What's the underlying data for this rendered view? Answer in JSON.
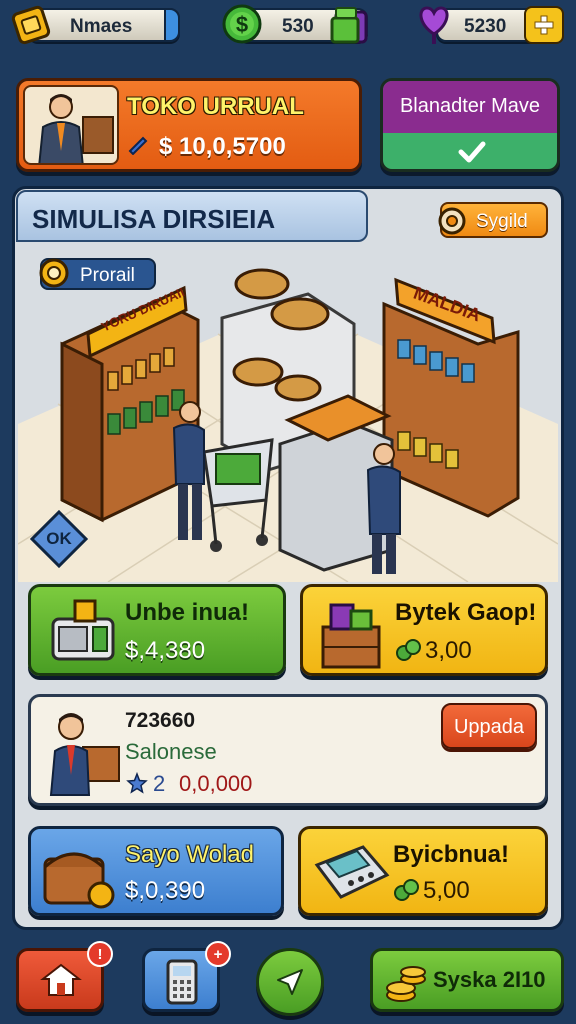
{
  "top_bar": {
    "name_label": "Nmaes",
    "cash_value": "530",
    "gems_value": "5230"
  },
  "store_card": {
    "title": "TOKO URRUAL",
    "money": "$ 10,0,5700"
  },
  "action_card": {
    "title": "Blanadter Mave"
  },
  "scene": {
    "title": "SIMULISA DIRSIEIA",
    "settings_button": "Sygild",
    "profile_tag": "Prorail",
    "ok_button": "OK",
    "shelf_left_sign": "YORU DIRUAII",
    "shelf_right_sign": "MALDIA"
  },
  "tiles": {
    "tile1": {
      "title": "Unbe inua!",
      "value": "$,4,380"
    },
    "tile2": {
      "title": "Bytek Gaop!",
      "value": "3,00"
    },
    "staff": {
      "number": "723660",
      "name": "Salonese",
      "level": "2",
      "money": "0,0,000",
      "button": "Uppada"
    },
    "tile3": {
      "title": "Sayo Wolad",
      "value": "$,0,390"
    },
    "tile4": {
      "title": "Byicbnua!",
      "value": "5,00"
    }
  },
  "bottom_bar": {
    "badge1": "!",
    "badge2": "+",
    "coins_label": "Syska 2I10"
  },
  "colors": {
    "background": "#1d3a5e",
    "orange": "#ef6a1f",
    "green": "#5cb530",
    "yellow": "#f4c21b",
    "blue": "#4a8fd9",
    "purple": "#8a2c8f"
  }
}
